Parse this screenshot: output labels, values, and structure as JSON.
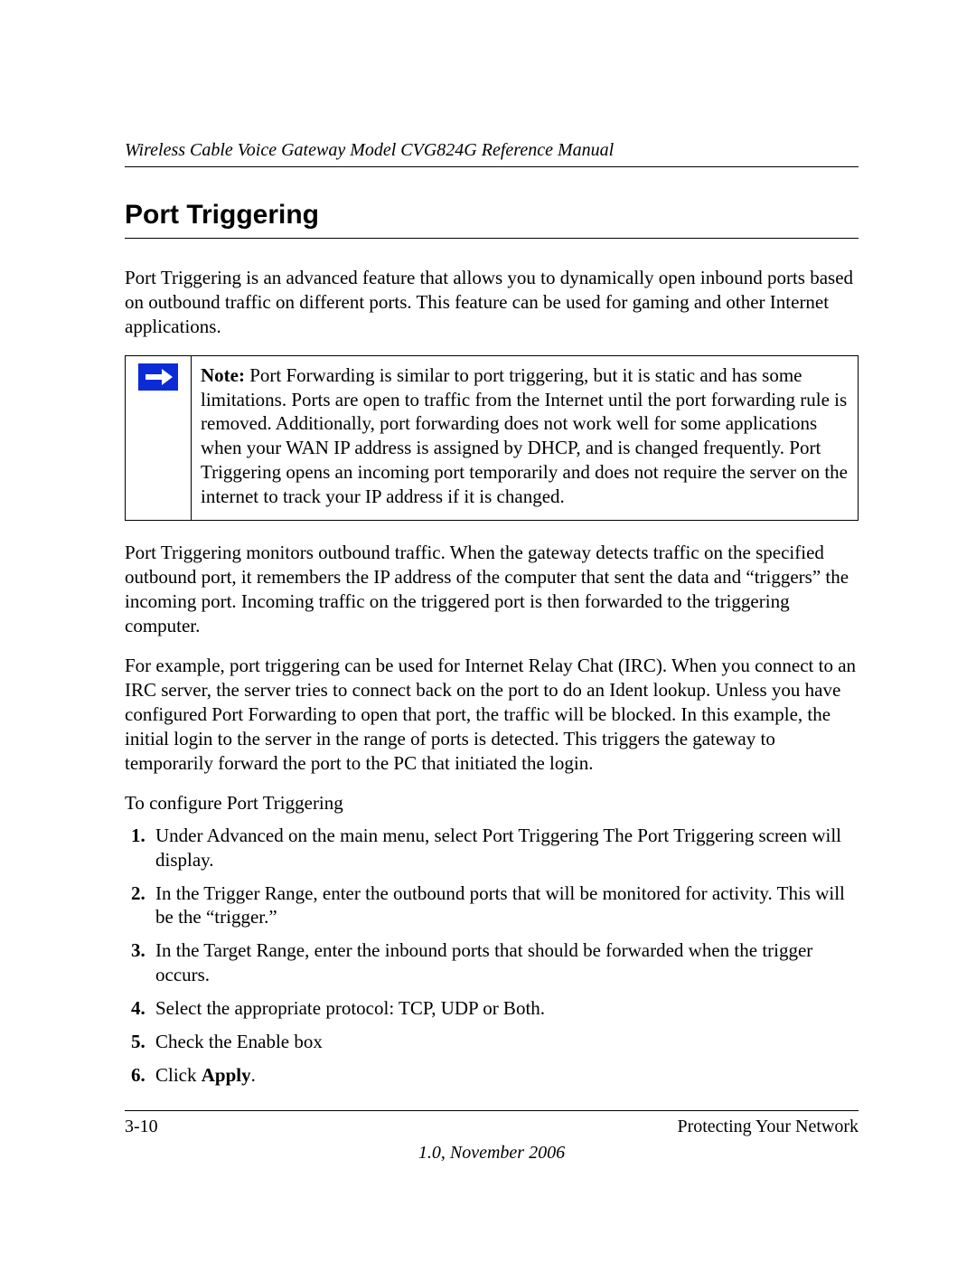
{
  "header": {
    "running_title": "Wireless Cable Voice Gateway Model CVG824G Reference Manual"
  },
  "section": {
    "title": "Port Triggering",
    "intro": "Port Triggering is an advanced feature that allows you to dynamically open inbound ports based on outbound traffic on different ports. This feature can be used for gaming and other Internet applications."
  },
  "note": {
    "label": "Note:",
    "text": " Port Forwarding is similar to port triggering, but it is static and has some limitations. Ports are open to traffic from the Internet until the port forwarding rule is removed. Additionally, port forwarding does not work well for some applications when your WAN IP address is assigned by DHCP, and is changed frequently. Port Triggering opens an incoming port temporarily and does not require the server on the internet to track your IP address if it is changed."
  },
  "paragraphs": {
    "p1": "Port Triggering monitors outbound traffic. When the gateway detects traffic on the specified outbound port, it remembers the IP address of the computer that sent the data and “triggers” the incoming port. Incoming traffic on the triggered port is then forwarded to the triggering computer.",
    "p2": "For example, port triggering can be used for Internet Relay Chat (IRC). When you connect to an IRC server, the server tries to connect back on the port to do an Ident lookup. Unless you have configured Port Forwarding to open that port, the traffic will be blocked. In this example, the initial login to the server in the range of ports is detected. This triggers the gateway to temporarily forward the port to the PC that initiated the login.",
    "lead": "To configure Port Triggering"
  },
  "steps": [
    "Under Advanced on the main menu, select Port Triggering The Port Triggering screen will display.",
    "In the Trigger Range, enter the outbound ports that will be monitored for activity. This will be the “trigger.”",
    "In the Target Range, enter the inbound ports that should be forwarded when the trigger occurs.",
    "Select the appropriate protocol: TCP, UDP or Both.",
    "Check the Enable box"
  ],
  "step6": {
    "prefix": "Click ",
    "bold": "Apply",
    "suffix": "."
  },
  "footer": {
    "page_number": "3-10",
    "section_name": "Protecting Your Network",
    "version_line": "1.0, November 2006"
  }
}
